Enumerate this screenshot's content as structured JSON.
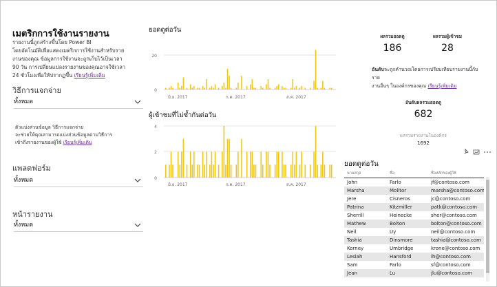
{
  "sidebar": {
    "title": "เมตริกการใช้งานรายงาน",
    "description_lines": [
      "รายงานนี้ถูกสร้างขึ้นโดย Power BI",
      "โดยอัตโนมัติเพื่อแสดงเมตริกการใช้งานสำหรับราย",
      "งานของคุณ ข้อมูลการใช้งานจะถูกเก็บไว้เป็นเวลา",
      "90 วัน การเปลี่ยนแปลงรายงานของคุณอาจใช้เวลา",
      "24 ชั่วโมงเพื่อให้ปรากฏขึ้น"
    ],
    "description_link": "เรียนรู้เพิ่มเติม",
    "slicers": [
      {
        "label": "วิธีการแจกจ่าย",
        "value": "ทั้งหมด"
      },
      {
        "label": "แพลตฟอร์ม",
        "value": "ทั้งหมด"
      },
      {
        "label": "หน้ารายงาน",
        "value": "ทั้งหมด"
      }
    ],
    "note_lines": [
      "ตัวแบ่งส่วนข้อมูล วิธีการแจกจ่าย",
      "จะช่วยให้คุณสามารถแบ่งส่วนข้อมูลตามวิธีการ",
      "เข้าถึงรายงานของผู้ใช้"
    ],
    "note_link": "เรียนรู้เพิ่มเติม"
  },
  "charts": {
    "views": {
      "title": "ยอดดูต่อวัน",
      "y_ticks": [
        "20",
        "0"
      ],
      "x_ticks": [
        "มิ.ย. 2017",
        "ก.ค. 2017",
        "ส.ค. 2017"
      ],
      "color": "#f2c80f"
    },
    "viewers": {
      "title": "ผู้เข้าชมที่ไม่ซ้ำกันต่อวัน",
      "y_ticks": [
        "4",
        "2",
        "0"
      ],
      "x_ticks": [
        "มิ.ย. 2017",
        "ก.ค. 2017",
        "ส.ค. 2017"
      ],
      "color": "#f2c80f"
    }
  },
  "chart_data": [
    {
      "type": "bar",
      "title": "ยอดดูต่อวัน",
      "ylim": [
        0,
        25
      ],
      "values": [
        1,
        0,
        1,
        2,
        1,
        0,
        0,
        4,
        1,
        2,
        7,
        0,
        1,
        0,
        3,
        1,
        2,
        0,
        1,
        1,
        0,
        2,
        1,
        6,
        0,
        1,
        2,
        1,
        3,
        0,
        1,
        0,
        2,
        4,
        1,
        12,
        8,
        1,
        0,
        0,
        1,
        4,
        0,
        8,
        0,
        0,
        2,
        0,
        3,
        6,
        1,
        1,
        0,
        0,
        2,
        1,
        0,
        3,
        6,
        1,
        0,
        0,
        1,
        2,
        3,
        0,
        2,
        1,
        1,
        0,
        0,
        1,
        6,
        1,
        2,
        0,
        1,
        2,
        0,
        1,
        0,
        0,
        1,
        0,
        5,
        23,
        1,
        0,
        1,
        5,
        1,
        0,
        0,
        1,
        1,
        0
      ]
    },
    {
      "type": "bar",
      "title": "ผู้เข้าชมที่ไม่ซ้ำกันต่อวัน",
      "ylim": [
        0,
        4
      ],
      "values": [
        1,
        0,
        1,
        2,
        1,
        0,
        0,
        2,
        1,
        2,
        3,
        0,
        1,
        0,
        2,
        1,
        2,
        0,
        1,
        1,
        0,
        2,
        1,
        2,
        0,
        1,
        2,
        1,
        2,
        0,
        1,
        0,
        2,
        4,
        1,
        3,
        3,
        1,
        0,
        0,
        1,
        2,
        0,
        3,
        0,
        0,
        2,
        0,
        2,
        2,
        1,
        1,
        0,
        0,
        2,
        1,
        0,
        2,
        2,
        1,
        0,
        0,
        1,
        2,
        2,
        0,
        2,
        1,
        1,
        0,
        0,
        1,
        2,
        1,
        2,
        0,
        1,
        2,
        0,
        1,
        0,
        0,
        1,
        0,
        2,
        4,
        1,
        0,
        1,
        2,
        1,
        0,
        0,
        1,
        1,
        0
      ]
    }
  ],
  "kpis": {
    "total_views_label": "ผลรวมยอดดู",
    "total_views": "186",
    "total_viewers_label": "ผลรวมผู้เข้าชม",
    "total_viewers": "28",
    "rank_note_prefix": "อันดับ",
    "rank_note_lines": [
      "จะถูกคำนวณโดยการเปรียบเทียบรายงานนี้กับราย",
      "งานอื่นๆ ในองค์กรของคุณ"
    ],
    "rank_note_link": "เรียนรู้เพิ่มเติม",
    "rank_label": "อันดับผลรวมยอดดู",
    "rank_value": "682",
    "org_reports_label": "ผลรวมรายงานในองค์กร",
    "org_reports_value": "1692"
  },
  "table": {
    "title": "ยอดดูต่อวัน",
    "columns": [
      "นามสกุล",
      "ชื่อ",
      "ชื่อหลักของผู้ใช้"
    ],
    "rows": [
      [
        "John",
        "Farlo",
        "jf@contoso.com"
      ],
      [
        "Marsha",
        "Molitor",
        "marsha@contoso.com"
      ],
      [
        "Jere",
        "Cisneros",
        "jc@contoso.com"
      ],
      [
        "Patrina",
        "Kitzmiller",
        "patk@contoso.com"
      ],
      [
        "Sherrill",
        "Heinecke",
        "sher@contoso.com"
      ],
      [
        "Mathew",
        "Bolton",
        "bolton@contoso.com"
      ],
      [
        "Neil",
        "Uy",
        "neil@contoso.com"
      ],
      [
        "Tashia",
        "Dinsmore",
        "tashia@contoso.com"
      ],
      [
        "Korney",
        "Umbridge",
        "krone@contoso.com"
      ],
      [
        "Lesiah",
        "Hansford",
        "lh@contoso.com"
      ],
      [
        "Sam",
        "Farlo",
        "sf@contoso.com"
      ],
      [
        "Jean",
        "Lu",
        "jlu@contoso.com"
      ]
    ]
  },
  "colors": {
    "accent": "#f2c80f",
    "link": "#6c2d91"
  },
  "icons": [
    "pin-icon",
    "focus-mode-icon",
    "more-options-icon",
    "chevron-down-icon"
  ]
}
